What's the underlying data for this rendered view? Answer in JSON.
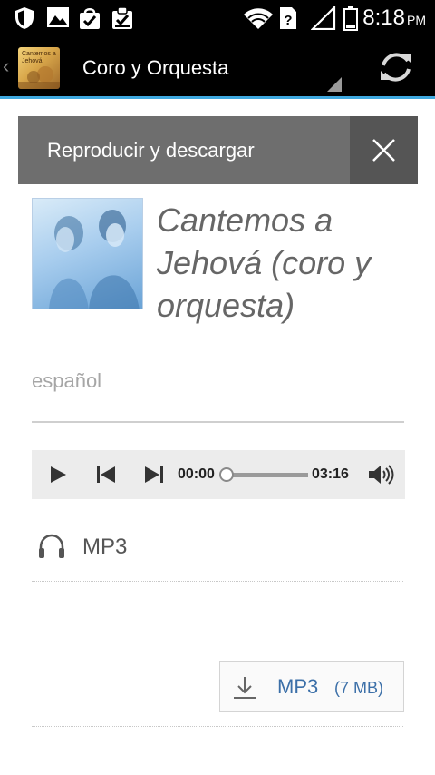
{
  "status_bar": {
    "time": "8:18",
    "ampm": "PM",
    "icons": [
      "shield-icon",
      "image-icon",
      "shopping-bag-check-icon",
      "clipboard-check-icon",
      "wifi-icon",
      "no-sim-icon",
      "signal-icon",
      "battery-icon"
    ]
  },
  "action_bar": {
    "title": "Coro y Orquesta",
    "logo_text": "Cantemos a Jehová",
    "accent_color": "#3fa9e0"
  },
  "panel": {
    "header_title": "Reproducir y descargar",
    "album_title": "Cantemos a Jehová (coro y orquesta)",
    "language": "español"
  },
  "player": {
    "current_time": "00:00",
    "duration": "03:16",
    "progress": 0
  },
  "format": {
    "label": "MP3",
    "icon": "headphones-icon"
  },
  "download": {
    "label": "MP3",
    "size": "(7 MB)",
    "icon": "download-icon",
    "color": "#3b6fa8"
  }
}
